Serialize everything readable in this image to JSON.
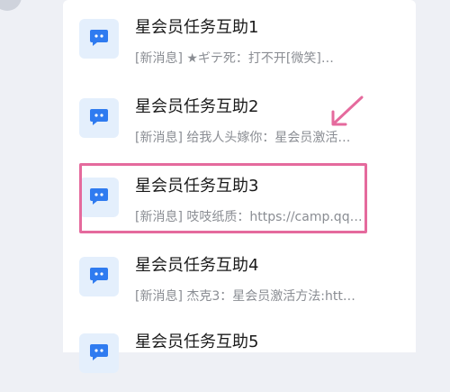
{
  "accent_color": "#e56a9d",
  "icon_color": "#2f7bf0",
  "chat_list": [
    {
      "title": "星会员任务互助1",
      "preview": "[新消息] ★ギテ死：打不开[微笑]…",
      "icon": "chat-bubble-icon"
    },
    {
      "title": "星会员任务互助2",
      "preview": "[新消息] 给我人头嫁你：星会员激活…",
      "icon": "chat-bubble-icon"
    },
    {
      "title": "星会员任务互助3",
      "preview": "[新消息] 吱吱纸质：https://camp.qq…",
      "icon": "chat-bubble-icon"
    },
    {
      "title": "星会员任务互助4",
      "preview": "[新消息] 杰克3：星会员激活方法:htt…",
      "icon": "chat-bubble-icon"
    },
    {
      "title": "星会员任务互助5",
      "preview": "",
      "icon": "chat-bubble-icon"
    }
  ]
}
